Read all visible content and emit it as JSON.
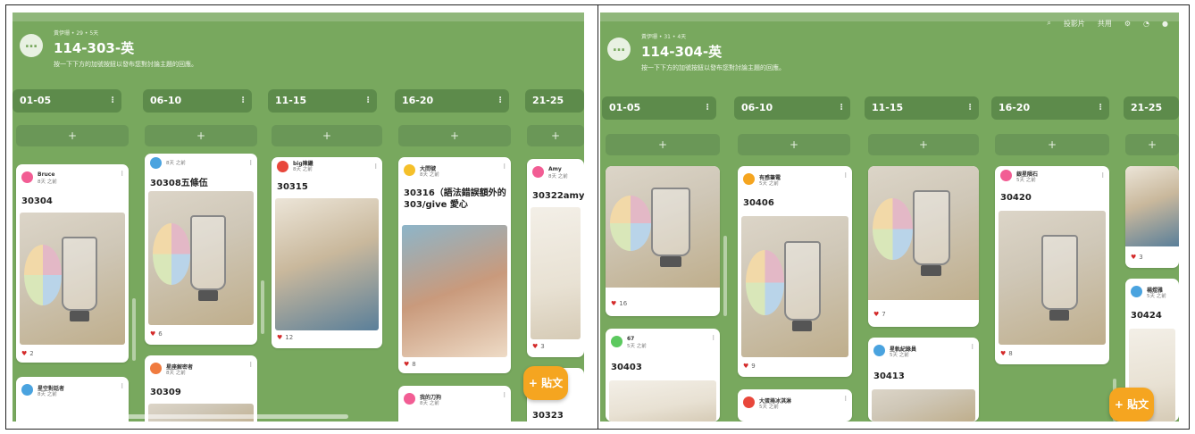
{
  "left": {
    "board": {
      "meta": "黃伊珊 • 29 • 5天",
      "title": "114-303-英",
      "description": "按一下下方的加號按鈕以發布您對討論主題的回應。",
      "icon": "chat-bubble-icon"
    },
    "columns": [
      "01-05",
      "06-10",
      "11-15",
      "16-20",
      "21-25"
    ],
    "add_label": "+",
    "cards": [
      {
        "author": "Bruce",
        "time": "8天 之前",
        "title": "30304",
        "likes": "2"
      },
      {
        "author": "星空對話者",
        "time": "8天 之前",
        "title": "",
        "likes": ""
      },
      {
        "author": "",
        "time": "8天 之前",
        "title": "30308五條伍",
        "likes": "6"
      },
      {
        "author": "星座解密者",
        "time": "8天 之前",
        "title": "30309",
        "likes": ""
      },
      {
        "author": "big陳繼",
        "time": "8天 之前",
        "title": "30315",
        "likes": "12"
      },
      {
        "author": "大問號",
        "time": "8天 之前",
        "title": "30316（語法錯誤額外的303/give 愛心",
        "likes": "8"
      },
      {
        "author": "我的刀狗",
        "time": "8天 之前",
        "title": "",
        "likes": ""
      },
      {
        "author": "Amy",
        "time": "8天 之前",
        "title": "30322amy",
        "likes": "3"
      },
      {
        "author": "",
        "time": "",
        "title": "30323",
        "likes": ""
      }
    ],
    "fab_label": "+ 貼文"
  },
  "right": {
    "board": {
      "meta": "黃伊珊 • 31 • 4天",
      "title": "114-304-英",
      "description": "按一下下方的加號按鈕以發布您對討論主題的回應。",
      "icon": "chat-bubble-icon"
    },
    "toolbar": [
      "投影片",
      "共用"
    ],
    "columns": [
      "01-05",
      "06-10",
      "11-15",
      "16-20",
      "21-25"
    ],
    "add_label": "+",
    "cards": [
      {
        "author": "",
        "time": "",
        "title": "",
        "likes": "16"
      },
      {
        "author": "67",
        "time": "5天 之前",
        "title": "30403",
        "likes": ""
      },
      {
        "author": "有感筆電",
        "time": "5天 之前",
        "title": "30406",
        "likes": "9"
      },
      {
        "author": "大蛋捲冰淇淋",
        "time": "5天 之前",
        "title": "",
        "likes": ""
      },
      {
        "author": "",
        "time": "",
        "title": "",
        "likes": "7"
      },
      {
        "author": "星軌紀錄員",
        "time": "5天 之前",
        "title": "30413",
        "likes": ""
      },
      {
        "author": "銀星隕石",
        "time": "5天 之前",
        "title": "30420",
        "likes": "8"
      },
      {
        "author": "",
        "time": "",
        "title": "",
        "likes": "3"
      },
      {
        "author": "楊煜雅",
        "time": "5天 之前",
        "title": "30424",
        "likes": ""
      }
    ],
    "fab_label": "+ 貼文"
  }
}
